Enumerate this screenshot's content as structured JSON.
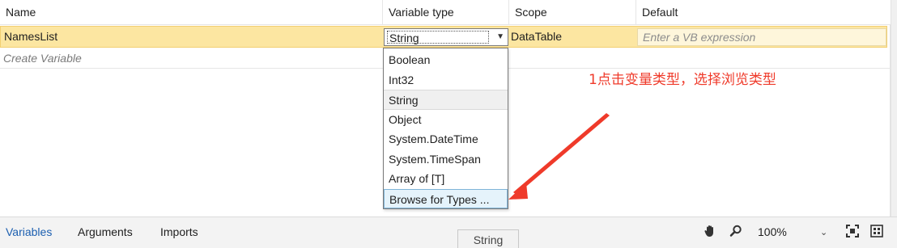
{
  "columns": {
    "name": "Name",
    "variable_type": "Variable type",
    "scope": "Scope",
    "default": "Default"
  },
  "selected_row": {
    "name": "NamesList",
    "variable_type": "String",
    "scope": "DataTable",
    "default_placeholder": "Enter a VB expression"
  },
  "create_variable_label": "Create Variable",
  "type_dropdown": {
    "items": [
      "Boolean",
      "Int32",
      "String",
      "Object",
      "System.DateTime",
      "System.TimeSpan",
      "Array of [T]",
      "Browse for Types ..."
    ],
    "selected": "String",
    "highlighted": "Browse for Types ..."
  },
  "annotation": "1点击变量类型，选择浏览类型",
  "annotation_color": "#ef3a2a",
  "bottom_tabs": {
    "variables": "Variables",
    "arguments": "Arguments",
    "imports": "Imports"
  },
  "toolbar": {
    "zoom": "100%",
    "icons": [
      "hand-icon",
      "zoom-icon",
      "fit-screen-icon",
      "overview-icon"
    ]
  },
  "tooltip": "String",
  "colors": {
    "selected_row": "#fce6a1",
    "active_tab": "#1c5fb0",
    "hover_item": "#e5f3fb"
  }
}
